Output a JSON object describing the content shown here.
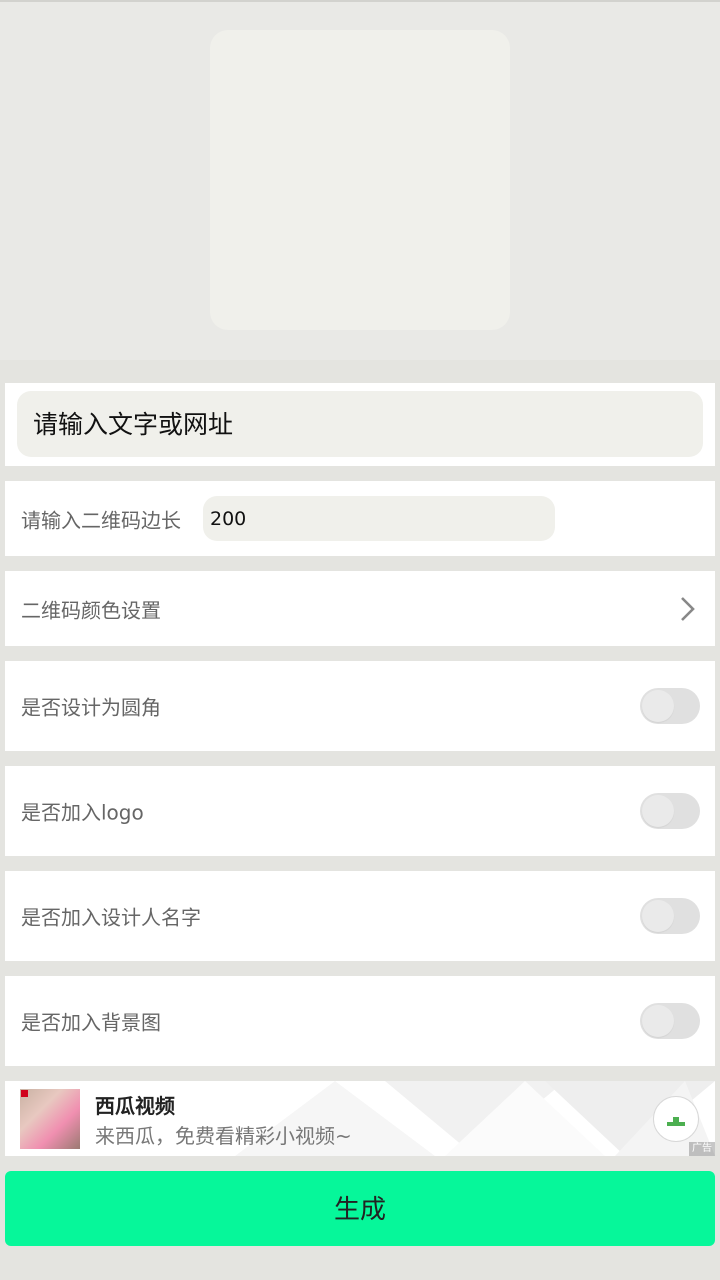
{
  "form": {
    "content_placeholder": "请输入文字或网址",
    "size_label": "请输入二维码边长",
    "size_value": "200",
    "color_setting_label": "二维码颜色设置"
  },
  "toggles": {
    "rounded_label": "是否设计为圆角",
    "rounded_on": false,
    "logo_label": "是否加入logo",
    "logo_on": false,
    "designer_name_label": "是否加入设计人名字",
    "designer_name_on": false,
    "background_label": "是否加入背景图",
    "background_on": false
  },
  "ad": {
    "title": "西瓜视频",
    "description": "来西瓜，免费看精彩小视频~",
    "tag": "广告",
    "download_icon": "download-icon"
  },
  "actions": {
    "generate_label": "生成"
  },
  "colors": {
    "accent": "#06f79a",
    "toggle_off": "#e0e0e0",
    "input_bg": "#f0f0eb"
  }
}
